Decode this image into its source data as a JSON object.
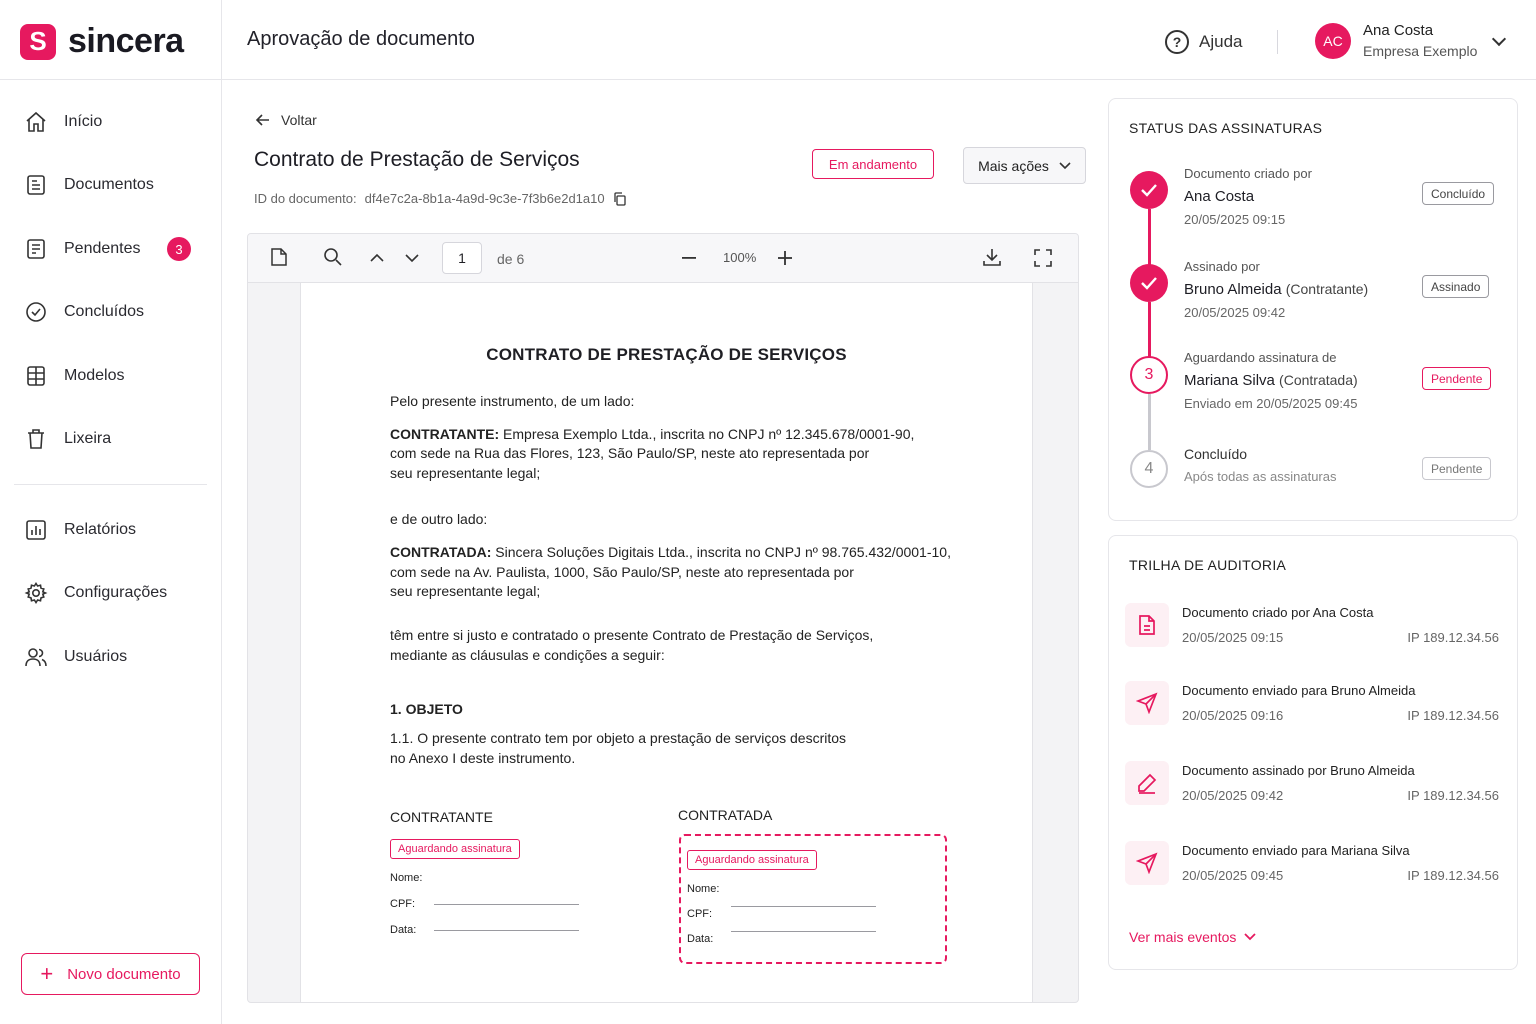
{
  "brand": {
    "logo_letter": "S",
    "name": "sincera"
  },
  "header": {
    "title": "Aprovação de documento",
    "help_label": "Ajuda",
    "user": {
      "initials": "AC",
      "name": "Ana Costa",
      "company": "Empresa Exemplo"
    }
  },
  "sidebar": {
    "items": [
      {
        "label": "Início",
        "icon": "home-icon"
      },
      {
        "label": "Documentos",
        "icon": "document-icon"
      },
      {
        "label": "Pendentes",
        "icon": "pending-document-icon",
        "badge": "3"
      },
      {
        "label": "Concluídos",
        "icon": "check-circle-icon"
      },
      {
        "label": "Modelos",
        "icon": "template-icon"
      },
      {
        "label": "Lixeira",
        "icon": "trash-icon"
      },
      {
        "label": "Relatórios",
        "icon": "chart-icon"
      },
      {
        "label": "Configurações",
        "icon": "gear-icon"
      },
      {
        "label": "Usuários",
        "icon": "users-icon"
      }
    ],
    "new_document_label": "Novo documento"
  },
  "main": {
    "back_label": "Voltar",
    "document_title": "Contrato de Prestação de Serviços",
    "status": "Em andamento",
    "more_actions_label": "Mais ações",
    "document_id_label": "ID do documento:",
    "document_id": "df4e7c2a-8b1a-4a9d-9c3e-7f3b6e2d1a10"
  },
  "viewer": {
    "current_page": "1",
    "total_pages": "de 6",
    "zoom": "100%"
  },
  "contract": {
    "title": "CONTRATO DE PRESTAÇÃO DE SERVIÇOS",
    "intro": "Pelo presente instrumento, de um lado:",
    "contratante_label": "CONTRATANTE:",
    "contratante_line1": "Empresa Exemplo Ltda., inscrita no CNPJ nº 12.345.678/0001-90,",
    "contratante_line2": "com sede na Rua das Flores, 123, São Paulo/SP, neste ato representada por",
    "contratante_line3": "seu representante legal;",
    "other_side": "e de outro lado:",
    "contratada_label": "CONTRATADA:",
    "contratada_line1": "Sincera Soluções Digitais Ltda., inscrita no CNPJ nº 98.765.432/0001-10,",
    "contratada_line2": "com sede na Av. Paulista, 1000, São Paulo/SP, neste ato representada por",
    "contratada_line3": "seu representante legal;",
    "agreement_line1": "têm entre si justo e contratado o presente Contrato de Prestação de Serviços,",
    "agreement_line2": "mediante as cláusulas e condições a seguir:",
    "section1_title": "1. OBJETO",
    "section1_line1": "1.1.  O presente contrato tem por objeto a prestação de serviços descritos",
    "section1_line2": "no Anexo I deste instrumento.",
    "signatures": [
      {
        "title": "CONTRATANTE",
        "status": "Aguardando assinatura",
        "name_label": "Nome:",
        "cpf_label": "CPF:",
        "date_label": "Data:"
      },
      {
        "title": "CONTRATADA",
        "status": "Aguardando assinatura",
        "name_label": "Nome:",
        "cpf_label": "CPF:",
        "date_label": "Data:"
      }
    ]
  },
  "signature_status": {
    "title": "STATUS DAS ASSINATURAS",
    "steps": [
      {
        "label": "Documento criado por",
        "name": "Ana Costa",
        "role": "",
        "date": "20/05/2025 09:15",
        "badge": "Concluído",
        "state": "done"
      },
      {
        "label": "Assinado por",
        "name": "Bruno Almeida",
        "role": "(Contratante)",
        "date": "20/05/2025 09:42",
        "badge": "Assinado",
        "state": "done"
      },
      {
        "label": "Aguardando assinatura de",
        "name": "Mariana Silva",
        "role": "(Contratada)",
        "date": "Enviado em 20/05/2025 09:45",
        "badge": "Pendente",
        "state": "current",
        "number": "3"
      },
      {
        "label": "Concluído",
        "name": "",
        "role": "",
        "date": "Após todas as assinaturas",
        "badge": "Pendente",
        "state": "upcoming",
        "number": "4"
      }
    ]
  },
  "audit": {
    "title": "TRILHA DE AUDITORIA",
    "events": [
      {
        "text": "Documento criado por Ana Costa",
        "date": "20/05/2025 09:15",
        "ip": "IP 189.12.34.56",
        "icon": "file-icon"
      },
      {
        "text": "Documento enviado para Bruno Almeida",
        "date": "20/05/2025 09:16",
        "ip": "IP 189.12.34.56",
        "icon": "send-icon"
      },
      {
        "text": "Documento assinado por Bruno Almeida",
        "date": "20/05/2025 09:42",
        "ip": "IP 189.12.34.56",
        "icon": "pen-icon"
      },
      {
        "text": "Documento enviado para Mariana Silva",
        "date": "20/05/2025 09:45",
        "ip": "IP 189.12.34.56",
        "icon": "send-icon"
      }
    ],
    "more_label": "Ver mais eventos"
  },
  "colors": {
    "accent": "#e6195f"
  }
}
